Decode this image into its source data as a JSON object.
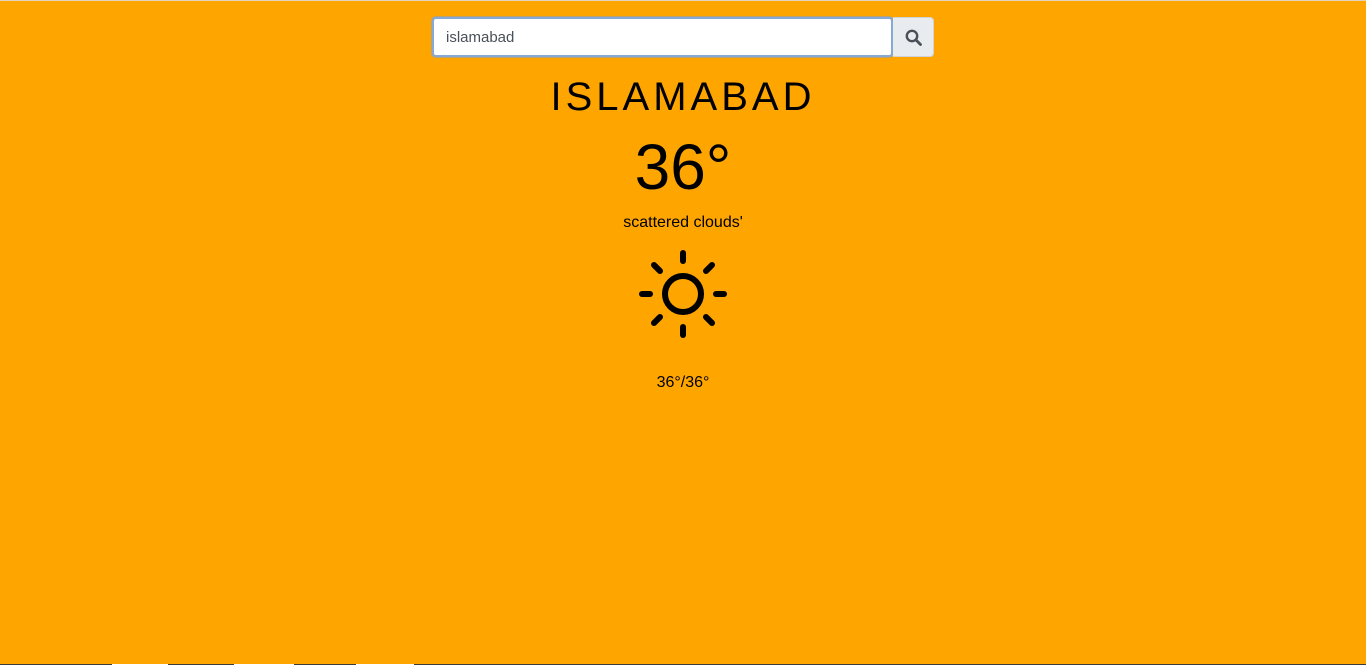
{
  "theme": {
    "background": "#FFA500",
    "text": "#000000",
    "input_focus_border": "#86A9D6",
    "button_bg": "#E9ECEF"
  },
  "search": {
    "value": "islamabad",
    "placeholder": "",
    "button_icon": "search-icon"
  },
  "weather": {
    "city": "ISLAMABAD",
    "temperature": "36°",
    "description": "scattered clouds'",
    "icon": "sun-icon",
    "min_max": "36°/36°"
  }
}
